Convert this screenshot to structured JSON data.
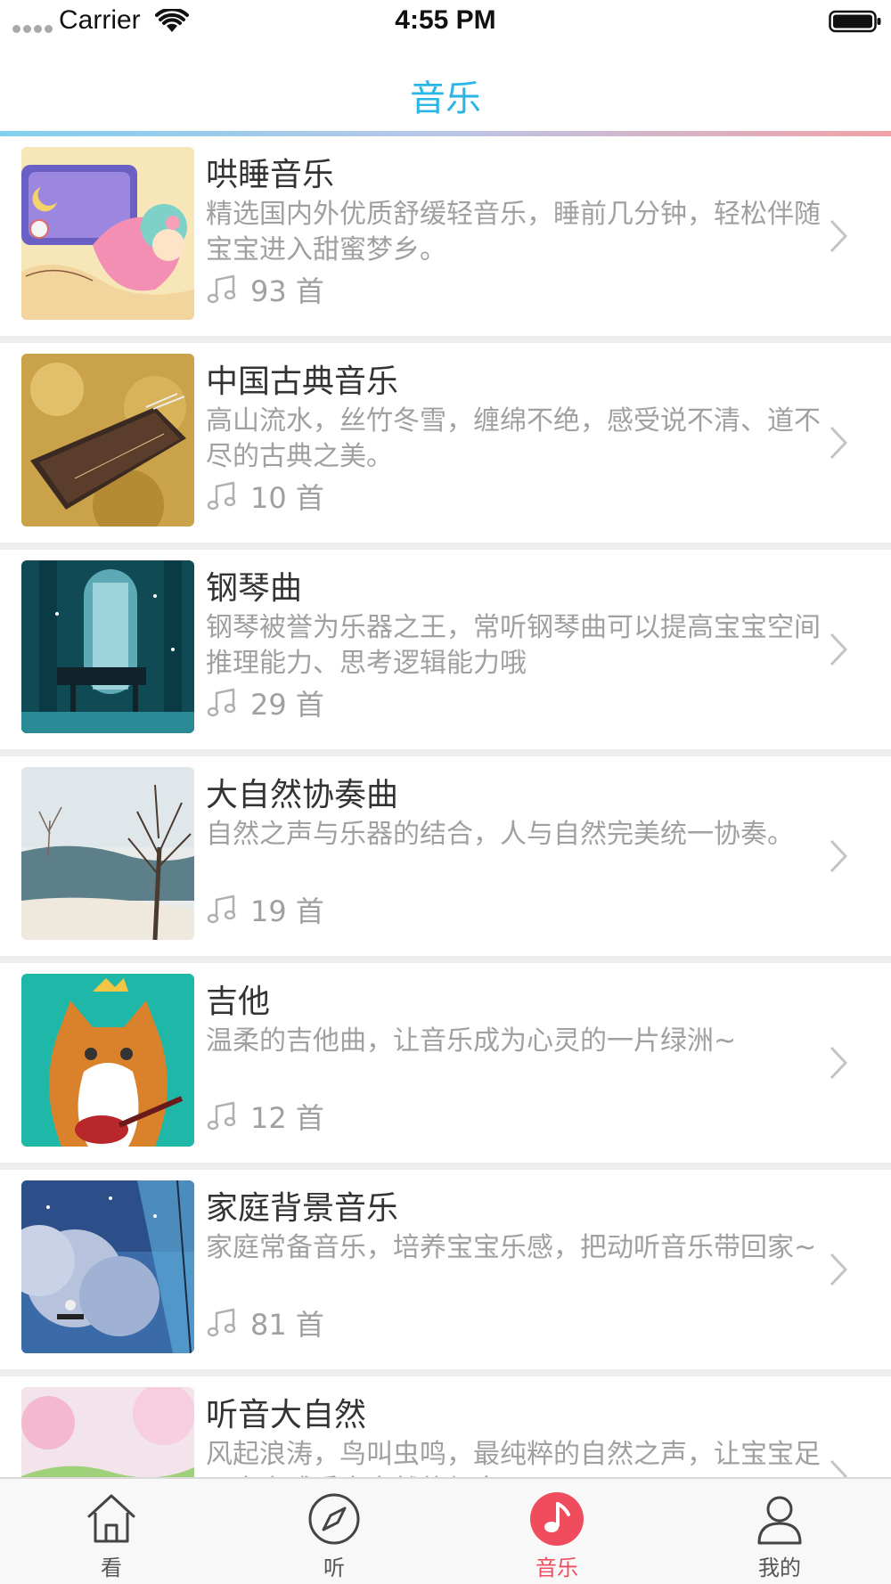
{
  "status_bar": {
    "carrier": "Carrier",
    "time": "4:55 PM"
  },
  "nav": {
    "title": "音乐",
    "title_color": "#29b6e6"
  },
  "list": [
    {
      "title": "哄睡音乐",
      "desc": "精选国内外优质舒缓轻音乐，睡前几分钟，轻松伴随宝宝进入甜蜜梦乡。",
      "count": "93 首"
    },
    {
      "title": "中国古典音乐",
      "desc": "高山流水，丝竹冬雪，缠绵不绝，感受说不清、道不尽的古典之美。",
      "count": "10 首"
    },
    {
      "title": "钢琴曲",
      "desc": "钢琴被誉为乐器之王，常听钢琴曲可以提高宝宝空间推理能力、思考逻辑能力哦",
      "count": "29 首"
    },
    {
      "title": "大自然协奏曲",
      "desc": "自然之声与乐器的结合，人与自然完美统一协奏。",
      "count": "19 首"
    },
    {
      "title": "吉他",
      "desc": "温柔的吉他曲，让音乐成为心灵的一片绿洲~",
      "count": "12 首"
    },
    {
      "title": "家庭背景音乐",
      "desc": "家庭常备音乐，培养宝宝乐感，把动听音乐带回家~",
      "count": "81 首"
    },
    {
      "title": "听音大自然",
      "desc": "风起浪涛，鸟叫虫鸣，最纯粹的自然之声，让宝宝足不出户感受大自然的气息。",
      "count": ""
    }
  ],
  "tabs": [
    {
      "label": "看",
      "icon": "home-icon"
    },
    {
      "label": "听",
      "icon": "compass-icon"
    },
    {
      "label": "音乐",
      "icon": "music-note-icon",
      "active": true
    },
    {
      "label": "我的",
      "icon": "person-icon"
    }
  ],
  "colors": {
    "accent_active": "#ef4d5e",
    "secondary_text": "#a0a0a0"
  }
}
